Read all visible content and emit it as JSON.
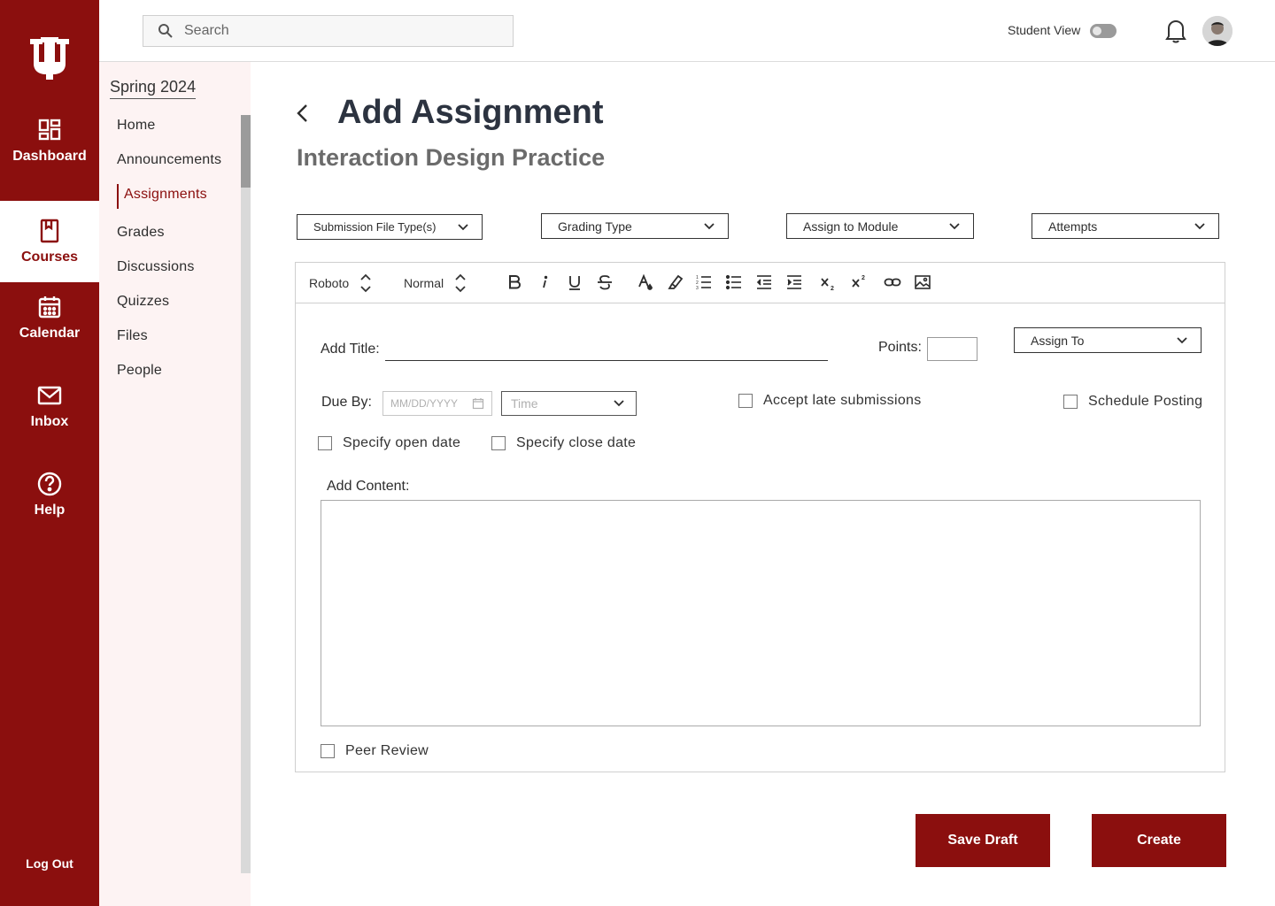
{
  "global_nav": {
    "items": [
      {
        "label": "Dashboard",
        "icon": "dashboard-icon"
      },
      {
        "label": "Courses",
        "icon": "book-icon"
      },
      {
        "label": "Calendar",
        "icon": "calendar-icon"
      },
      {
        "label": "Inbox",
        "icon": "envelope-icon"
      },
      {
        "label": "Help",
        "icon": "question-icon"
      }
    ],
    "logout": "Log Out",
    "brand_color": "#8b0f0e"
  },
  "topbar": {
    "search_placeholder": "Search",
    "student_view": "Student View"
  },
  "course_nav": {
    "term": "Spring 2024",
    "items": [
      {
        "label": "Home"
      },
      {
        "label": "Announcements"
      },
      {
        "label": "Assignments",
        "active": true
      },
      {
        "label": "Grades"
      },
      {
        "label": "Discussions"
      },
      {
        "label": "Quizzes"
      },
      {
        "label": "Files"
      },
      {
        "label": "People"
      }
    ]
  },
  "main": {
    "title": "Add Assignment",
    "subtitle": "Interaction Design Practice",
    "dropdowns": {
      "file_type": "Submission File Type(s)",
      "grading_type": "Grading Type",
      "module": "Assign to Module",
      "attempts": "Attempts"
    },
    "toolbar": {
      "font": "Roboto",
      "style": "Normal"
    },
    "form": {
      "add_title_label": "Add Title:",
      "points_label": "Points:",
      "assign_to": "Assign To",
      "due_by_label": "Due By:",
      "date_placeholder": "MM/DD/YYYY",
      "time_placeholder": "Time",
      "accept_late": "Accept late submissions",
      "schedule_posting": "Schedule Posting",
      "open_date": "Specify open date",
      "close_date": "Specify close date",
      "add_content_label": "Add Content:",
      "peer_review": "Peer Review"
    },
    "buttons": {
      "save_draft": "Save Draft",
      "create": "Create"
    }
  }
}
